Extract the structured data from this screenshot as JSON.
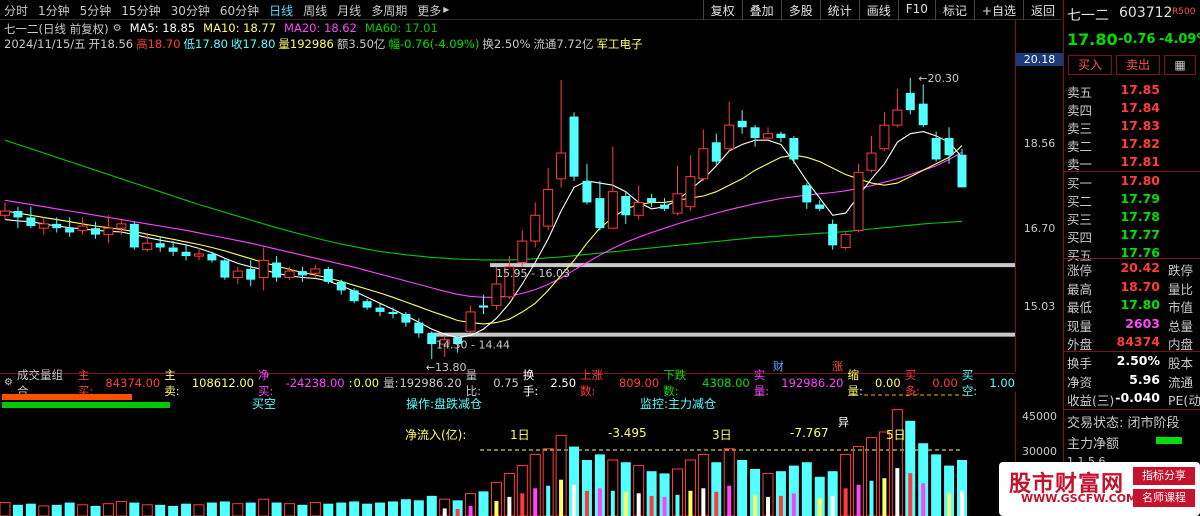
{
  "toolbar": {
    "periods": [
      "分时",
      "1分钟",
      "5分钟",
      "15分钟",
      "30分钟",
      "60分钟",
      "日线",
      "周线",
      "月线",
      "多周期",
      "更多"
    ],
    "active_period": "日线",
    "more_suffix": "▸",
    "tools": [
      "复权",
      "叠加",
      "多股",
      "统计",
      "画线",
      "F10",
      "标记",
      "+自选",
      "返回"
    ]
  },
  "header": {
    "stock_label": "七一二(日线 前复权)",
    "ma5": "MA5: 18.85",
    "ma10": "MA10: 18.77",
    "ma20": "MA20: 18.62",
    "ma60": "MA60: 17.01",
    "date": "2024/11/15/五",
    "open": "开18.56",
    "high": "高18.70",
    "low": "低17.80",
    "close": "收17.80",
    "volume": "量192986",
    "amount": "额3.50亿",
    "change": "幅-0.76(-4.09%)",
    "turnover": "换2.50%",
    "float_cap": "流通7.72亿",
    "sector": "军工电子"
  },
  "colors": {
    "up": "#ff3c3c",
    "down": "#54ffff",
    "ma5": "#ffffff",
    "ma10": "#ffff66",
    "ma20": "#ff44ff",
    "ma60": "#00c800",
    "label": "#c8c8c8",
    "axis_border": "#7a1515"
  },
  "chart_data": {
    "type": "candlestick",
    "y_axis_labels": [
      "20.18",
      "18.56",
      "16.70",
      "15.03"
    ],
    "annotations": {
      "high_marker": "20.30",
      "low_marker": "13.80",
      "zone_upper": "15.95 - 16.03",
      "zone_lower": "14.30 - 14.44",
      "event_cai": "财",
      "event_zhang": "涨"
    },
    "candles": [
      {
        "o": 17.15,
        "c": 17.25,
        "h": 17.45,
        "l": 17.05
      },
      {
        "o": 17.25,
        "c": 17.1,
        "h": 17.35,
        "l": 16.85
      },
      {
        "o": 17.1,
        "c": 16.9,
        "h": 17.35,
        "l": 16.85
      },
      {
        "o": 16.85,
        "c": 16.95,
        "h": 17.1,
        "l": 16.7
      },
      {
        "o": 16.95,
        "c": 16.85,
        "h": 17.1,
        "l": 16.75
      },
      {
        "o": 16.85,
        "c": 16.75,
        "h": 17.1,
        "l": 16.65
      },
      {
        "o": 16.8,
        "c": 16.9,
        "h": 17.1,
        "l": 16.7
      },
      {
        "o": 16.85,
        "c": 16.7,
        "h": 17.0,
        "l": 16.6
      },
      {
        "o": 16.7,
        "c": 16.85,
        "h": 17.15,
        "l": 16.5
      },
      {
        "o": 16.85,
        "c": 16.95,
        "h": 17.05,
        "l": 16.7
      },
      {
        "o": 16.95,
        "c": 16.4,
        "h": 17.0,
        "l": 16.35
      },
      {
        "o": 16.35,
        "c": 16.5,
        "h": 16.7,
        "l": 16.3
      },
      {
        "o": 16.5,
        "c": 16.4,
        "h": 16.65,
        "l": 16.3
      },
      {
        "o": 16.4,
        "c": 16.3,
        "h": 16.55,
        "l": 16.2
      },
      {
        "o": 16.3,
        "c": 16.2,
        "h": 16.45,
        "l": 16.1
      },
      {
        "o": 16.2,
        "c": 16.25,
        "h": 16.4,
        "l": 16.1
      },
      {
        "o": 16.25,
        "c": 16.1,
        "h": 16.3,
        "l": 16.05
      },
      {
        "o": 16.1,
        "c": 15.7,
        "h": 16.15,
        "l": 15.65
      },
      {
        "o": 15.7,
        "c": 15.85,
        "h": 15.95,
        "l": 15.55
      },
      {
        "o": 15.9,
        "c": 15.65,
        "h": 16.1,
        "l": 15.5
      },
      {
        "o": 15.7,
        "c": 16.1,
        "h": 16.4,
        "l": 15.4
      },
      {
        "o": 16.05,
        "c": 15.7,
        "h": 16.2,
        "l": 15.6
      },
      {
        "o": 15.7,
        "c": 15.85,
        "h": 15.95,
        "l": 15.65
      },
      {
        "o": 15.85,
        "c": 15.75,
        "h": 15.95,
        "l": 15.6
      },
      {
        "o": 15.8,
        "c": 15.9,
        "h": 16.0,
        "l": 15.7
      },
      {
        "o": 15.9,
        "c": 15.6,
        "h": 15.95,
        "l": 15.55
      },
      {
        "o": 15.6,
        "c": 15.4,
        "h": 15.65,
        "l": 15.3
      },
      {
        "o": 15.4,
        "c": 15.15,
        "h": 15.45,
        "l": 15.1
      },
      {
        "o": 15.15,
        "c": 15.0,
        "h": 15.2,
        "l": 14.95
      },
      {
        "o": 15.0,
        "c": 14.9,
        "h": 15.1,
        "l": 14.8
      },
      {
        "o": 14.9,
        "c": 14.85,
        "h": 15.0,
        "l": 14.75
      },
      {
        "o": 14.85,
        "c": 14.65,
        "h": 14.9,
        "l": 14.55
      },
      {
        "o": 14.65,
        "c": 14.4,
        "h": 14.75,
        "l": 14.3
      },
      {
        "o": 14.4,
        "c": 14.15,
        "h": 14.45,
        "l": 13.8
      },
      {
        "o": 14.15,
        "c": 14.25,
        "h": 14.35,
        "l": 13.85
      },
      {
        "o": 14.3,
        "c": 14.15,
        "h": 14.4,
        "l": 13.95
      },
      {
        "o": 14.45,
        "c": 14.9,
        "h": 15.05,
        "l": 14.4
      },
      {
        "o": 15.05,
        "c": 15.0,
        "h": 15.3,
        "l": 14.85
      },
      {
        "o": 15.05,
        "c": 15.55,
        "h": 15.95,
        "l": 14.95
      },
      {
        "o": 15.25,
        "c": 15.95,
        "h": 16.2,
        "l": 15.2
      },
      {
        "o": 16.05,
        "c": 16.55,
        "h": 16.8,
        "l": 15.95
      },
      {
        "o": 16.55,
        "c": 17.15,
        "h": 17.45,
        "l": 16.4
      },
      {
        "o": 16.9,
        "c": 17.75,
        "h": 18.25,
        "l": 16.8
      },
      {
        "o": 18.0,
        "c": 18.6,
        "h": 20.3,
        "l": 17.8
      },
      {
        "o": 19.45,
        "c": 18.05,
        "h": 19.55,
        "l": 17.95
      },
      {
        "o": 17.95,
        "c": 17.45,
        "h": 18.35,
        "l": 17.4
      },
      {
        "o": 17.55,
        "c": 16.85,
        "h": 17.95,
        "l": 16.8
      },
      {
        "o": 16.85,
        "c": 17.7,
        "h": 18.75,
        "l": 16.85
      },
      {
        "o": 17.6,
        "c": 17.15,
        "h": 17.7,
        "l": 16.95
      },
      {
        "o": 17.15,
        "c": 17.45,
        "h": 17.85,
        "l": 17.05
      },
      {
        "o": 17.55,
        "c": 17.45,
        "h": 17.65,
        "l": 17.35
      },
      {
        "o": 17.4,
        "c": 17.3,
        "h": 17.55,
        "l": 17.25
      },
      {
        "o": 17.2,
        "c": 17.65,
        "h": 18.3,
        "l": 17.15
      },
      {
        "o": 17.35,
        "c": 18.05,
        "h": 18.55,
        "l": 17.25
      },
      {
        "o": 18.0,
        "c": 18.7,
        "h": 19.15,
        "l": 17.95
      },
      {
        "o": 18.85,
        "c": 18.4,
        "h": 19.05,
        "l": 18.3
      },
      {
        "o": 18.7,
        "c": 19.25,
        "h": 19.8,
        "l": 18.65
      },
      {
        "o": 19.35,
        "c": 19.2,
        "h": 19.6,
        "l": 19.05
      },
      {
        "o": 19.2,
        "c": 18.95,
        "h": 19.25,
        "l": 18.75
      },
      {
        "o": 18.95,
        "c": 19.05,
        "h": 19.2,
        "l": 18.9
      },
      {
        "o": 19.05,
        "c": 18.95,
        "h": 19.1,
        "l": 18.85
      },
      {
        "o": 18.95,
        "c": 18.45,
        "h": 19.0,
        "l": 18.35
      },
      {
        "o": 17.85,
        "c": 17.45,
        "h": 17.9,
        "l": 17.3
      },
      {
        "o": 17.4,
        "c": 17.3,
        "h": 17.5,
        "l": 17.25
      },
      {
        "o": 16.95,
        "c": 16.45,
        "h": 17.05,
        "l": 16.35
      },
      {
        "o": 16.4,
        "c": 16.7,
        "h": 16.75,
        "l": 16.35
      },
      {
        "o": 16.8,
        "c": 18.15,
        "h": 18.35,
        "l": 16.75
      },
      {
        "o": 18.2,
        "c": 18.6,
        "h": 19.0,
        "l": 18.15
      },
      {
        "o": 18.7,
        "c": 19.25,
        "h": 19.55,
        "l": 18.65
      },
      {
        "o": 19.25,
        "c": 19.6,
        "h": 20.1,
        "l": 19.2
      },
      {
        "o": 20.0,
        "c": 19.6,
        "h": 20.35,
        "l": 19.5
      },
      {
        "o": 19.75,
        "c": 19.25,
        "h": 20.2,
        "l": 19.2
      },
      {
        "o": 18.95,
        "c": 18.45,
        "h": 19.1,
        "l": 18.4
      },
      {
        "o": 18.95,
        "c": 18.55,
        "h": 19.2,
        "l": 18.35
      },
      {
        "o": 18.56,
        "c": 17.8,
        "h": 18.7,
        "l": 17.8
      }
    ],
    "ma5": [
      17.05,
      17.02,
      17.0,
      16.95,
      16.9,
      16.86,
      16.83,
      16.8,
      16.78,
      16.76,
      16.7,
      16.63,
      16.57,
      16.52,
      16.46,
      16.38,
      16.28,
      16.15,
      16.03,
      15.95,
      15.88,
      15.8,
      15.74,
      15.7,
      15.68,
      15.62,
      15.51,
      15.38,
      15.24,
      15.1,
      14.96,
      14.81,
      14.66,
      14.5,
      14.38,
      14.3,
      14.35,
      14.5,
      14.75,
      15.1,
      15.55,
      16.05,
      16.6,
      17.25,
      17.8,
      17.95,
      17.9,
      17.85,
      17.7,
      17.45,
      17.3,
      17.35,
      17.5,
      17.75,
      18.0,
      18.3,
      18.65,
      18.8,
      18.9,
      18.9,
      18.8,
      18.4,
      17.95,
      17.55,
      17.15,
      17.2,
      17.6,
      18.0,
      18.35,
      18.85,
      19.05,
      19.1,
      19.0,
      18.85,
      18.5
    ],
    "ma10": [
      17.25,
      17.2,
      17.15,
      17.1,
      17.05,
      17.0,
      16.95,
      16.9,
      16.86,
      16.82,
      16.77,
      16.71,
      16.65,
      16.59,
      16.53,
      16.47,
      16.4,
      16.32,
      16.23,
      16.14,
      16.05,
      15.97,
      15.89,
      15.82,
      15.76,
      15.69,
      15.61,
      15.52,
      15.43,
      15.34,
      15.24,
      15.13,
      15.02,
      14.91,
      14.81,
      14.7,
      14.65,
      14.62,
      14.65,
      14.73,
      14.9,
      15.1,
      15.4,
      15.75,
      16.1,
      16.5,
      16.85,
      17.1,
      17.3,
      17.4,
      17.45,
      17.45,
      17.5,
      17.55,
      17.6,
      17.7,
      17.85,
      18.0,
      18.2,
      18.35,
      18.5,
      18.55,
      18.5,
      18.4,
      18.25,
      18.1,
      18.0,
      17.9,
      17.85,
      17.9,
      18.05,
      18.2,
      18.35,
      18.5,
      18.77
    ],
    "ma20": [
      17.5,
      17.45,
      17.4,
      17.35,
      17.3,
      17.25,
      17.2,
      17.15,
      17.1,
      17.05,
      17.0,
      16.95,
      16.9,
      16.85,
      16.8,
      16.74,
      16.68,
      16.62,
      16.56,
      16.5,
      16.43,
      16.36,
      16.29,
      16.22,
      16.15,
      16.08,
      16.01,
      15.94,
      15.86,
      15.78,
      15.7,
      15.62,
      15.54,
      15.46,
      15.38,
      15.31,
      15.26,
      15.24,
      15.24,
      15.27,
      15.33,
      15.42,
      15.54,
      15.69,
      15.87,
      16.05,
      16.22,
      16.38,
      16.52,
      16.64,
      16.75,
      16.85,
      16.95,
      17.04,
      17.12,
      17.2,
      17.28,
      17.35,
      17.42,
      17.48,
      17.54,
      17.58,
      17.62,
      17.65,
      17.68,
      17.72,
      17.78,
      17.84,
      17.92,
      18.0,
      18.1,
      18.2,
      18.3,
      18.45,
      18.62
    ],
    "ma60": [
      18.9,
      18.8,
      18.7,
      18.6,
      18.5,
      18.4,
      18.3,
      18.2,
      18.1,
      18.0,
      17.9,
      17.8,
      17.7,
      17.6,
      17.5,
      17.4,
      17.31,
      17.22,
      17.13,
      17.04,
      16.95,
      16.86,
      16.78,
      16.7,
      16.62,
      16.55,
      16.48,
      16.42,
      16.36,
      16.31,
      16.27,
      16.23,
      16.2,
      16.17,
      16.15,
      16.13,
      16.12,
      16.11,
      16.11,
      16.11,
      16.12,
      16.14,
      16.16,
      16.18,
      16.21,
      16.24,
      16.27,
      16.3,
      16.33,
      16.36,
      16.39,
      16.42,
      16.45,
      16.48,
      16.51,
      16.54,
      16.57,
      16.6,
      16.63,
      16.65,
      16.67,
      16.69,
      16.71,
      16.73,
      16.75,
      16.77,
      16.8,
      16.83,
      16.86,
      16.89,
      16.92,
      16.95,
      16.97,
      16.99,
      17.01
    ]
  },
  "volume_panel": {
    "title": "成交量组合",
    "buy_label": "主买:",
    "buy_value": "84374.00",
    "sell_label": "主卖:",
    "sell_value": "108612.00",
    "net_label": "净买:",
    "net_value": "-24238.00",
    "colon_label": ":",
    "colon_value": "0.00",
    "vol_label": "量:",
    "vol_value": "192986.20",
    "ratio_label": "量比:",
    "ratio_value": "0.75",
    "turnover_label": "换手:",
    "turnover_value": "2.50",
    "up_count_label": "上涨数:",
    "up_count_value": "809.00",
    "down_count_label": "下跌数:",
    "down_count_value": "4308.00",
    "real_vol_label": "实量:",
    "real_vol_value": "192986.20",
    "shrink_label": "缩量:",
    "shrink_value": "0.00",
    "buy_more_label": "买多:",
    "buy_more_value": "0.00",
    "buy_empty_label": "买空:",
    "buy_empty_value": "1.00",
    "signal_buy_empty": "买空",
    "signal_op": "操作:盘跌减仓",
    "signal_monitor": "监控:主力减仓",
    "net_flow_label": "净流入(亿):",
    "d1_label": "1日",
    "d1_value": "-3.495",
    "d3_label": "3日",
    "d3_value": "-7.767",
    "d5_label": "5日",
    "yi_marker": "异",
    "y_axis_labels": [
      "45000",
      "30000"
    ],
    "bars": [
      0.12,
      0.1,
      0.11,
      0.09,
      0.1,
      0.12,
      0.1,
      0.09,
      0.11,
      0.13,
      0.12,
      0.1,
      0.1,
      0.09,
      0.11,
      0.1,
      0.12,
      0.13,
      0.11,
      0.12,
      0.15,
      0.12,
      0.11,
      0.1,
      0.12,
      0.11,
      0.12,
      0.13,
      0.11,
      0.12,
      0.13,
      0.15,
      0.14,
      0.18,
      0.15,
      0.14,
      0.2,
      0.22,
      0.3,
      0.38,
      0.45,
      0.55,
      0.6,
      0.72,
      0.62,
      0.5,
      0.55,
      0.5,
      0.48,
      0.45,
      0.4,
      0.38,
      0.42,
      0.5,
      0.55,
      0.48,
      0.6,
      0.5,
      0.42,
      0.38,
      0.4,
      0.45,
      0.48,
      0.35,
      0.4,
      0.55,
      0.62,
      0.7,
      0.75,
      0.95,
      0.85,
      0.65,
      0.55,
      0.45,
      0.5
    ]
  },
  "panel": {
    "name": "七一二",
    "code": "603712",
    "r_badge": "R500",
    "price": "17.80",
    "change": "-0.76",
    "change_pct": "-4.09%",
    "buy_btn": "买入",
    "sell_btn": "卖出",
    "asks": [
      {
        "label": "卖五",
        "price": "17.85"
      },
      {
        "label": "卖四",
        "price": "17.84"
      },
      {
        "label": "卖三",
        "price": "17.83"
      },
      {
        "label": "卖二",
        "price": "17.82"
      },
      {
        "label": "卖一",
        "price": "17.81"
      }
    ],
    "bids": [
      {
        "label": "买一",
        "price": "17.80"
      },
      {
        "label": "买二",
        "price": "17.79"
      },
      {
        "label": "买三",
        "price": "17.78"
      },
      {
        "label": "买四",
        "price": "17.77"
      },
      {
        "label": "买五",
        "price": "17.76"
      }
    ],
    "stats": [
      {
        "label": "涨停",
        "value": "20.42",
        "right": "跌停",
        "color": "#ff3c3c"
      },
      {
        "label": "最高",
        "value": "18.70",
        "right": "量比",
        "color": "#ff3c3c"
      },
      {
        "label": "最低",
        "value": "17.80",
        "right": "市值",
        "color": "#00e000"
      },
      {
        "label": "现量",
        "value": "2603",
        "right": "总量",
        "color": "#ff44ff"
      },
      {
        "label": "外盘",
        "value": "84374",
        "right": "内盘",
        "color": "#ff3c3c"
      }
    ],
    "stats2": [
      {
        "label": "换手",
        "value": "2.50%",
        "right": "股本",
        "color": "#ffffff"
      },
      {
        "label": "净资",
        "value": "5.96",
        "right": "流通",
        "color": "#ffffff"
      },
      {
        "label": "收益(三)",
        "value": "-0.040",
        "right": "PE(动)",
        "color": "#ffffff"
      }
    ],
    "trade_status": "交易状态: 闭市阶段",
    "net_amount": "主力净额",
    "partial": "1.1.5.6"
  },
  "watermark": {
    "cn": "股市财富网",
    "url": "WWW.GSCFW.COM",
    "b1": "指标分享",
    "b2": "名师课程"
  }
}
